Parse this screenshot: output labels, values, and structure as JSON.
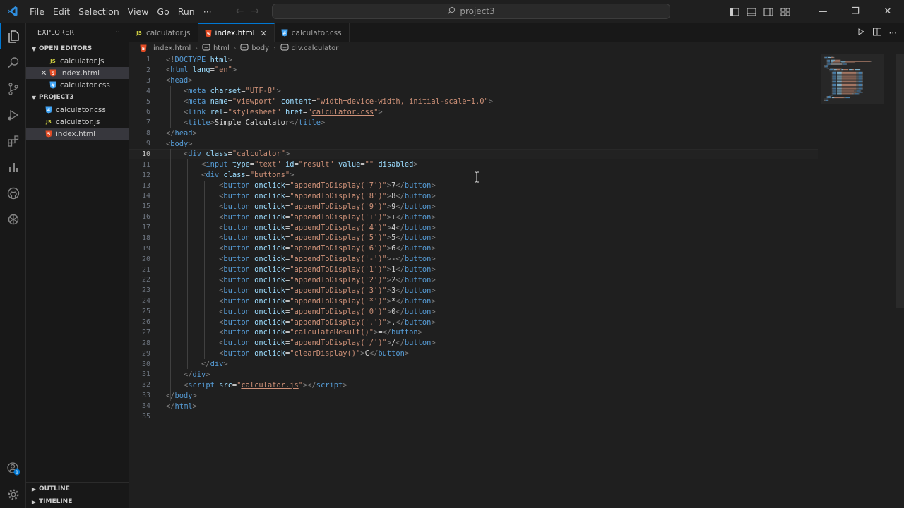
{
  "menu": [
    "File",
    "Edit",
    "Selection",
    "View",
    "Go",
    "Run"
  ],
  "menu_more": "···",
  "search": {
    "text": "project3"
  },
  "window": {
    "minimize": "—",
    "maximize": "❐",
    "close": "✕"
  },
  "explorer": {
    "title": "EXPLORER",
    "more": "···",
    "open_editors_label": "OPEN EDITORS",
    "open_editors": [
      {
        "name": "calculator.js",
        "icon": "js-file-icon"
      },
      {
        "name": "index.html",
        "icon": "html-file-icon"
      },
      {
        "name": "calculator.css",
        "icon": "css-file-icon"
      }
    ],
    "project_label": "PROJECT3",
    "project_files": [
      {
        "name": "calculator.css",
        "icon": "css-file-icon"
      },
      {
        "name": "calculator.js",
        "icon": "js-file-icon"
      },
      {
        "name": "index.html",
        "icon": "html-file-icon"
      }
    ],
    "outline_label": "OUTLINE",
    "timeline_label": "TIMELINE"
  },
  "tabs": [
    {
      "name": "calculator.js",
      "type": "js"
    },
    {
      "name": "index.html",
      "type": "html"
    },
    {
      "name": "calculator.css",
      "type": "css"
    }
  ],
  "file_badges": {
    "js": "JS",
    "css": "#",
    "html": "5"
  },
  "accounts_badge": "1",
  "breadcrumb": [
    "index.html",
    "html",
    "body",
    "div.calculator"
  ],
  "current_line": 10,
  "colors": {
    "accent": "#0078d4",
    "tag": "#569cd6",
    "attribute": "#9cdcfe",
    "string": "#ce9178",
    "text": "#d4d4d4",
    "bracket": "#808080"
  },
  "code_lines": [
    [
      [
        "br",
        "<!"
      ],
      [
        "tg",
        "DOCTYPE "
      ],
      [
        "at",
        "html"
      ],
      [
        "br",
        ">"
      ]
    ],
    [
      [
        "br",
        "<"
      ],
      [
        "tg",
        "html "
      ],
      [
        "at",
        "lang"
      ],
      [
        "tx",
        "="
      ],
      [
        "sv",
        "\"en\""
      ],
      [
        "br",
        ">"
      ]
    ],
    [
      [
        "br",
        "<"
      ],
      [
        "tg",
        "head"
      ],
      [
        "br",
        ">"
      ]
    ],
    [
      [
        "tx",
        "    "
      ],
      [
        "br",
        "<"
      ],
      [
        "tg",
        "meta "
      ],
      [
        "at",
        "charset"
      ],
      [
        "tx",
        "="
      ],
      [
        "sv",
        "\"UTF-8\""
      ],
      [
        "br",
        ">"
      ]
    ],
    [
      [
        "tx",
        "    "
      ],
      [
        "br",
        "<"
      ],
      [
        "tg",
        "meta "
      ],
      [
        "at",
        "name"
      ],
      [
        "tx",
        "="
      ],
      [
        "sv",
        "\"viewport\" "
      ],
      [
        "at",
        "content"
      ],
      [
        "tx",
        "="
      ],
      [
        "sv",
        "\"width=device-width, initial-scale=1.0\""
      ],
      [
        "br",
        ">"
      ]
    ],
    [
      [
        "tx",
        "    "
      ],
      [
        "br",
        "<"
      ],
      [
        "tg",
        "link "
      ],
      [
        "at",
        "rel"
      ],
      [
        "tx",
        "="
      ],
      [
        "sv",
        "\"stylesheet\" "
      ],
      [
        "at",
        "href"
      ],
      [
        "tx",
        "="
      ],
      [
        "sv",
        "\""
      ],
      [
        "svu",
        "calculator.css"
      ],
      [
        "sv",
        "\""
      ],
      [
        "br",
        ">"
      ]
    ],
    [
      [
        "tx",
        "    "
      ],
      [
        "br",
        "<"
      ],
      [
        "tg",
        "title"
      ],
      [
        "br",
        ">"
      ],
      [
        "tx",
        "Simple Calculator"
      ],
      [
        "br",
        "</"
      ],
      [
        "tg",
        "title"
      ],
      [
        "br",
        ">"
      ]
    ],
    [
      [
        "br",
        "</"
      ],
      [
        "tg",
        "head"
      ],
      [
        "br",
        ">"
      ]
    ],
    [
      [
        "br",
        "<"
      ],
      [
        "tg",
        "body"
      ],
      [
        "br",
        ">"
      ]
    ],
    [
      [
        "tx",
        "    "
      ],
      [
        "br",
        "<"
      ],
      [
        "tg",
        "div "
      ],
      [
        "at",
        "class"
      ],
      [
        "tx",
        "="
      ],
      [
        "sv",
        "\"calculator\""
      ],
      [
        "br",
        ">"
      ]
    ],
    [
      [
        "tx",
        "        "
      ],
      [
        "br",
        "<"
      ],
      [
        "tg",
        "input "
      ],
      [
        "at",
        "type"
      ],
      [
        "tx",
        "="
      ],
      [
        "sv",
        "\"text\" "
      ],
      [
        "at",
        "id"
      ],
      [
        "tx",
        "="
      ],
      [
        "sv",
        "\"result\" "
      ],
      [
        "at",
        "value"
      ],
      [
        "tx",
        "="
      ],
      [
        "sv",
        "\"\" "
      ],
      [
        "at",
        "disabled"
      ],
      [
        "br",
        ">"
      ]
    ],
    [
      [
        "tx",
        "        "
      ],
      [
        "br",
        "<"
      ],
      [
        "tg",
        "div "
      ],
      [
        "at",
        "class"
      ],
      [
        "tx",
        "="
      ],
      [
        "sv",
        "\"buttons\""
      ],
      [
        "br",
        ">"
      ]
    ],
    [
      [
        "tx",
        "            "
      ],
      [
        "br",
        "<"
      ],
      [
        "tg",
        "button "
      ],
      [
        "at",
        "onclick"
      ],
      [
        "tx",
        "="
      ],
      [
        "sv",
        "\"appendToDisplay('7')\""
      ],
      [
        "br",
        ">"
      ],
      [
        "tx",
        "7"
      ],
      [
        "br",
        "</"
      ],
      [
        "tg",
        "button"
      ],
      [
        "br",
        ">"
      ]
    ],
    [
      [
        "tx",
        "            "
      ],
      [
        "br",
        "<"
      ],
      [
        "tg",
        "button "
      ],
      [
        "at",
        "onclick"
      ],
      [
        "tx",
        "="
      ],
      [
        "sv",
        "\"appendToDisplay('8')\""
      ],
      [
        "br",
        ">"
      ],
      [
        "tx",
        "8"
      ],
      [
        "br",
        "</"
      ],
      [
        "tg",
        "button"
      ],
      [
        "br",
        ">"
      ]
    ],
    [
      [
        "tx",
        "            "
      ],
      [
        "br",
        "<"
      ],
      [
        "tg",
        "button "
      ],
      [
        "at",
        "onclick"
      ],
      [
        "tx",
        "="
      ],
      [
        "sv",
        "\"appendToDisplay('9')\""
      ],
      [
        "br",
        ">"
      ],
      [
        "tx",
        "9"
      ],
      [
        "br",
        "</"
      ],
      [
        "tg",
        "button"
      ],
      [
        "br",
        ">"
      ]
    ],
    [
      [
        "tx",
        "            "
      ],
      [
        "br",
        "<"
      ],
      [
        "tg",
        "button "
      ],
      [
        "at",
        "onclick"
      ],
      [
        "tx",
        "="
      ],
      [
        "sv",
        "\"appendToDisplay('+')\""
      ],
      [
        "br",
        ">"
      ],
      [
        "tx",
        "+"
      ],
      [
        "br",
        "</"
      ],
      [
        "tg",
        "button"
      ],
      [
        "br",
        ">"
      ]
    ],
    [
      [
        "tx",
        "            "
      ],
      [
        "br",
        "<"
      ],
      [
        "tg",
        "button "
      ],
      [
        "at",
        "onclick"
      ],
      [
        "tx",
        "="
      ],
      [
        "sv",
        "\"appendToDisplay('4')\""
      ],
      [
        "br",
        ">"
      ],
      [
        "tx",
        "4"
      ],
      [
        "br",
        "</"
      ],
      [
        "tg",
        "button"
      ],
      [
        "br",
        ">"
      ]
    ],
    [
      [
        "tx",
        "            "
      ],
      [
        "br",
        "<"
      ],
      [
        "tg",
        "button "
      ],
      [
        "at",
        "onclick"
      ],
      [
        "tx",
        "="
      ],
      [
        "sv",
        "\"appendToDisplay('5')\""
      ],
      [
        "br",
        ">"
      ],
      [
        "tx",
        "5"
      ],
      [
        "br",
        "</"
      ],
      [
        "tg",
        "button"
      ],
      [
        "br",
        ">"
      ]
    ],
    [
      [
        "tx",
        "            "
      ],
      [
        "br",
        "<"
      ],
      [
        "tg",
        "button "
      ],
      [
        "at",
        "onclick"
      ],
      [
        "tx",
        "="
      ],
      [
        "sv",
        "\"appendToDisplay('6')\""
      ],
      [
        "br",
        ">"
      ],
      [
        "tx",
        "6"
      ],
      [
        "br",
        "</"
      ],
      [
        "tg",
        "button"
      ],
      [
        "br",
        ">"
      ]
    ],
    [
      [
        "tx",
        "            "
      ],
      [
        "br",
        "<"
      ],
      [
        "tg",
        "button "
      ],
      [
        "at",
        "onclick"
      ],
      [
        "tx",
        "="
      ],
      [
        "sv",
        "\"appendToDisplay('-')\""
      ],
      [
        "br",
        ">"
      ],
      [
        "tx",
        "-"
      ],
      [
        "br",
        "</"
      ],
      [
        "tg",
        "button"
      ],
      [
        "br",
        ">"
      ]
    ],
    [
      [
        "tx",
        "            "
      ],
      [
        "br",
        "<"
      ],
      [
        "tg",
        "button "
      ],
      [
        "at",
        "onclick"
      ],
      [
        "tx",
        "="
      ],
      [
        "sv",
        "\"appendToDisplay('1')\""
      ],
      [
        "br",
        ">"
      ],
      [
        "tx",
        "1"
      ],
      [
        "br",
        "</"
      ],
      [
        "tg",
        "button"
      ],
      [
        "br",
        ">"
      ]
    ],
    [
      [
        "tx",
        "            "
      ],
      [
        "br",
        "<"
      ],
      [
        "tg",
        "button "
      ],
      [
        "at",
        "onclick"
      ],
      [
        "tx",
        "="
      ],
      [
        "sv",
        "\"appendToDisplay('2')\""
      ],
      [
        "br",
        ">"
      ],
      [
        "tx",
        "2"
      ],
      [
        "br",
        "</"
      ],
      [
        "tg",
        "button"
      ],
      [
        "br",
        ">"
      ]
    ],
    [
      [
        "tx",
        "            "
      ],
      [
        "br",
        "<"
      ],
      [
        "tg",
        "button "
      ],
      [
        "at",
        "onclick"
      ],
      [
        "tx",
        "="
      ],
      [
        "sv",
        "\"appendToDisplay('3')\""
      ],
      [
        "br",
        ">"
      ],
      [
        "tx",
        "3"
      ],
      [
        "br",
        "</"
      ],
      [
        "tg",
        "button"
      ],
      [
        "br",
        ">"
      ]
    ],
    [
      [
        "tx",
        "            "
      ],
      [
        "br",
        "<"
      ],
      [
        "tg",
        "button "
      ],
      [
        "at",
        "onclick"
      ],
      [
        "tx",
        "="
      ],
      [
        "sv",
        "\"appendToDisplay('*')\""
      ],
      [
        "br",
        ">"
      ],
      [
        "tx",
        "*"
      ],
      [
        "br",
        "</"
      ],
      [
        "tg",
        "button"
      ],
      [
        "br",
        ">"
      ]
    ],
    [
      [
        "tx",
        "            "
      ],
      [
        "br",
        "<"
      ],
      [
        "tg",
        "button "
      ],
      [
        "at",
        "onclick"
      ],
      [
        "tx",
        "="
      ],
      [
        "sv",
        "\"appendToDisplay('0')\""
      ],
      [
        "br",
        ">"
      ],
      [
        "tx",
        "0"
      ],
      [
        "br",
        "</"
      ],
      [
        "tg",
        "button"
      ],
      [
        "br",
        ">"
      ]
    ],
    [
      [
        "tx",
        "            "
      ],
      [
        "br",
        "<"
      ],
      [
        "tg",
        "button "
      ],
      [
        "at",
        "onclick"
      ],
      [
        "tx",
        "="
      ],
      [
        "sv",
        "\"appendToDisplay('.')\""
      ],
      [
        "br",
        ">"
      ],
      [
        "tx",
        "."
      ],
      [
        "br",
        "</"
      ],
      [
        "tg",
        "button"
      ],
      [
        "br",
        ">"
      ]
    ],
    [
      [
        "tx",
        "            "
      ],
      [
        "br",
        "<"
      ],
      [
        "tg",
        "button "
      ],
      [
        "at",
        "onclick"
      ],
      [
        "tx",
        "="
      ],
      [
        "sv",
        "\"calculateResult()\""
      ],
      [
        "br",
        ">"
      ],
      [
        "tx",
        "="
      ],
      [
        "br",
        "</"
      ],
      [
        "tg",
        "button"
      ],
      [
        "br",
        ">"
      ]
    ],
    [
      [
        "tx",
        "            "
      ],
      [
        "br",
        "<"
      ],
      [
        "tg",
        "button "
      ],
      [
        "at",
        "onclick"
      ],
      [
        "tx",
        "="
      ],
      [
        "sv",
        "\"appendToDisplay('/')\""
      ],
      [
        "br",
        ">"
      ],
      [
        "tx",
        "/"
      ],
      [
        "br",
        "</"
      ],
      [
        "tg",
        "button"
      ],
      [
        "br",
        ">"
      ]
    ],
    [
      [
        "tx",
        "            "
      ],
      [
        "br",
        "<"
      ],
      [
        "tg",
        "button "
      ],
      [
        "at",
        "onclick"
      ],
      [
        "tx",
        "="
      ],
      [
        "sv",
        "\"clearDisplay()\""
      ],
      [
        "br",
        ">"
      ],
      [
        "tx",
        "C"
      ],
      [
        "br",
        "</"
      ],
      [
        "tg",
        "button"
      ],
      [
        "br",
        ">"
      ]
    ],
    [
      [
        "tx",
        "        "
      ],
      [
        "br",
        "</"
      ],
      [
        "tg",
        "div"
      ],
      [
        "br",
        ">"
      ]
    ],
    [
      [
        "tx",
        "    "
      ],
      [
        "br",
        "</"
      ],
      [
        "tg",
        "div"
      ],
      [
        "br",
        ">"
      ]
    ],
    [
      [
        "tx",
        "    "
      ],
      [
        "br",
        "<"
      ],
      [
        "tg",
        "script "
      ],
      [
        "at",
        "src"
      ],
      [
        "tx",
        "="
      ],
      [
        "sv",
        "\""
      ],
      [
        "svu",
        "calculator.js"
      ],
      [
        "sv",
        "\""
      ],
      [
        "br",
        "></"
      ],
      [
        "tg",
        "script"
      ],
      [
        "br",
        ">"
      ]
    ],
    [
      [
        "br",
        "</"
      ],
      [
        "tg",
        "body"
      ],
      [
        "br",
        ">"
      ]
    ],
    [
      [
        "br",
        "</"
      ],
      [
        "tg",
        "html"
      ],
      [
        "br",
        ">"
      ]
    ],
    []
  ]
}
